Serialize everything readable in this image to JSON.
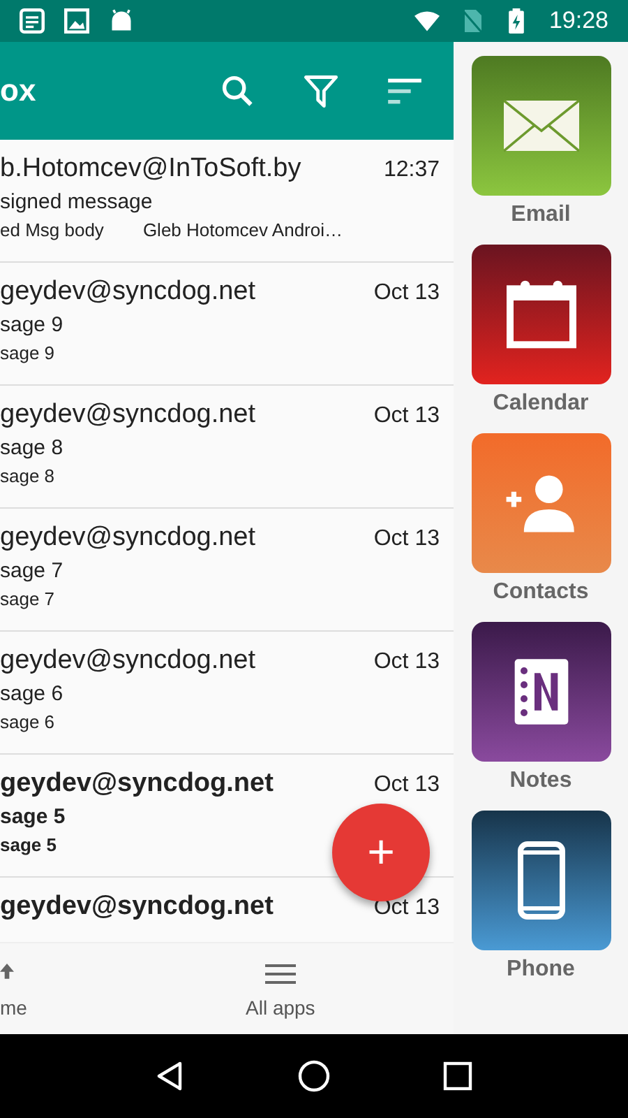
{
  "status_bar": {
    "time": "19:28"
  },
  "toolbar": {
    "title": "ox"
  },
  "messages": [
    {
      "sender": "b.Hotomcev@InToSoft.by",
      "time": "12:37",
      "subject": "signed message",
      "preview": [
        "ed Msg body",
        "Gleb Hotomcev Androi…"
      ],
      "unread": false
    },
    {
      "sender": "geydev@syncdog.net",
      "time": "Oct 13",
      "subject": "sage 9",
      "preview": [
        "sage 9"
      ],
      "unread": false
    },
    {
      "sender": "geydev@syncdog.net",
      "time": "Oct 13",
      "subject": "sage 8",
      "preview": [
        "sage 8"
      ],
      "unread": false
    },
    {
      "sender": "geydev@syncdog.net",
      "time": "Oct 13",
      "subject": "sage 7",
      "preview": [
        "sage 7"
      ],
      "unread": false
    },
    {
      "sender": "geydev@syncdog.net",
      "time": "Oct 13",
      "subject": "sage 6",
      "preview": [
        "sage 6"
      ],
      "unread": false
    },
    {
      "sender": "geydev@syncdog.net",
      "time": "Oct 13",
      "subject": "sage 5",
      "preview": [
        "sage 5"
      ],
      "unread": true
    },
    {
      "sender": "geydev@syncdog.net",
      "time": "Oct 13",
      "unread": true
    }
  ],
  "fab": {
    "label": "+"
  },
  "bottom_nav": [
    {
      "kind": "home",
      "label": "me"
    },
    {
      "kind": "apps",
      "label": "All apps"
    }
  ],
  "dock": [
    {
      "kind": "email",
      "label": "Email"
    },
    {
      "kind": "calendar",
      "label": "Calendar"
    },
    {
      "kind": "contacts",
      "label": "Contacts"
    },
    {
      "kind": "notes",
      "label": "Notes"
    },
    {
      "kind": "phone",
      "label": "Phone"
    }
  ]
}
